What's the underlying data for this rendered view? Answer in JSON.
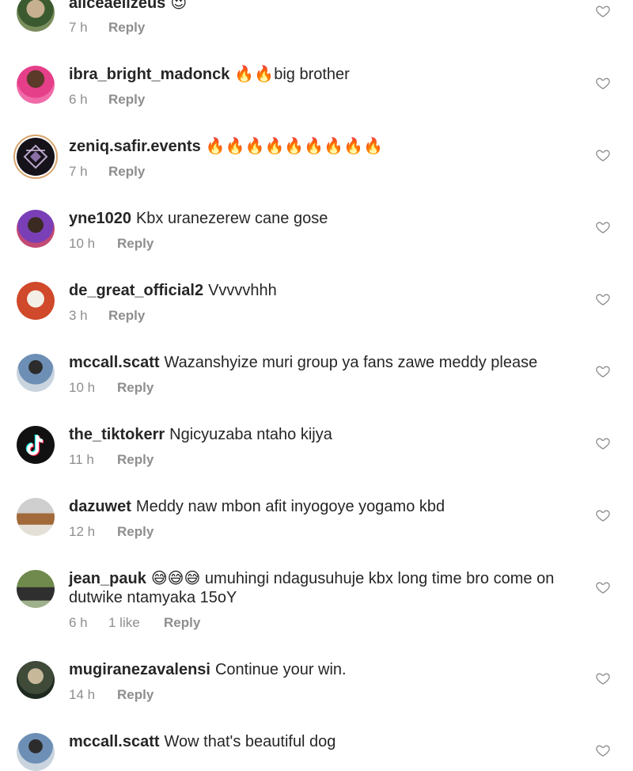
{
  "comments": [
    {
      "username": "aliceaelizeus",
      "text": "😍",
      "time": "7 h",
      "likes": "",
      "reply": "Reply",
      "avatar": "avatar-photo"
    },
    {
      "username": "ibra_bright_madonck",
      "text": "🔥🔥big brother",
      "time": "6 h",
      "likes": "",
      "reply": "Reply",
      "avatar": "avatar-photo"
    },
    {
      "username": "zeniq.safir.events",
      "text": "🔥🔥🔥🔥🔥🔥🔥🔥🔥",
      "time": "7 h",
      "likes": "",
      "reply": "Reply",
      "avatar": "avatar-logo-story-ring"
    },
    {
      "username": "yne1020",
      "text": "Kbx uranezerew cane gose",
      "time": "10 h",
      "likes": "",
      "reply": "Reply",
      "avatar": "avatar-photo"
    },
    {
      "username": "de_great_official2",
      "text": "Vvvvvhhh",
      "time": "3 h",
      "likes": "",
      "reply": "Reply",
      "avatar": "avatar-photo"
    },
    {
      "username": "mccall.scatt",
      "text": "Wazanshyize muri group ya fans zawe meddy please",
      "time": "10 h",
      "likes": "",
      "reply": "Reply",
      "avatar": "avatar-photo"
    },
    {
      "username": "the_tiktokerr",
      "text": "Ngicyuzaba ntaho kijya",
      "time": "11 h",
      "likes": "",
      "reply": "Reply",
      "avatar": "avatar-tiktok-logo"
    },
    {
      "username": "dazuwet",
      "text": "Meddy naw mbon afit inyogoye yogamo kbd",
      "time": "12 h",
      "likes": "",
      "reply": "Reply",
      "avatar": "avatar-photo"
    },
    {
      "username": "jean_pauk",
      "text": "😅😅😅 umuhingi ndagusuhuje kbx long time  bro come on dutwike ntamyaka 15oY",
      "time": "6 h",
      "likes": "1 like",
      "reply": "Reply",
      "avatar": "avatar-photo"
    },
    {
      "username": "mugiranezavalensi",
      "text": "Continue your win.",
      "time": "14 h",
      "likes": "",
      "reply": "Reply",
      "avatar": "avatar-photo"
    },
    {
      "username": "mccall.scatt",
      "text": "Wow that's beautiful dog",
      "time": "",
      "likes": "",
      "reply": "",
      "avatar": "avatar-photo"
    }
  ],
  "icons": {
    "like": "heart-outline-icon"
  },
  "colors": {
    "text": "#262626",
    "meta": "#8e8e8e",
    "story_ring": "#d9a36b"
  }
}
